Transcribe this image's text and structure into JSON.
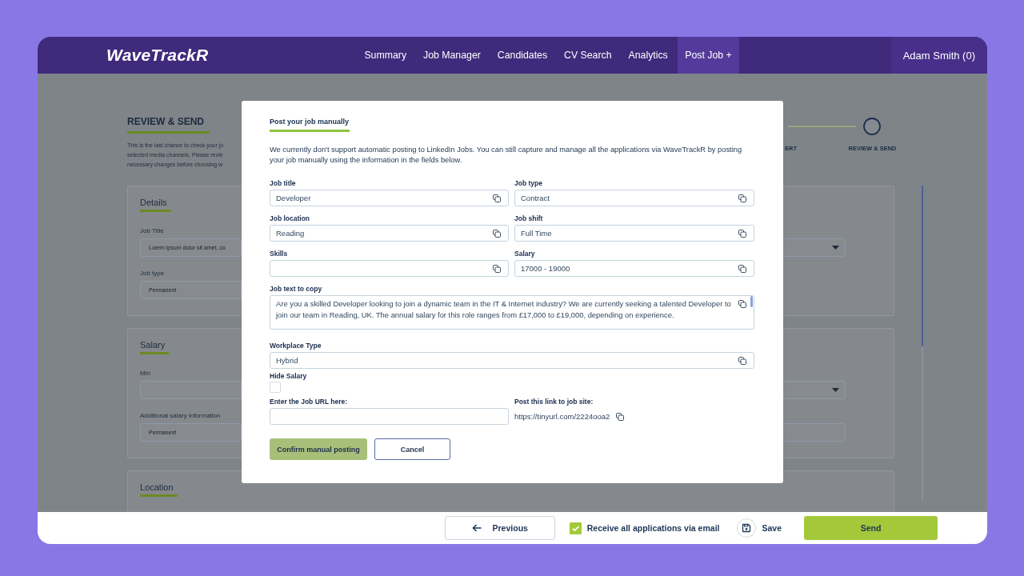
{
  "header": {
    "logo": "WaveTrackR",
    "nav": [
      {
        "label": "Summary",
        "selected": false
      },
      {
        "label": "Job Manager",
        "selected": false
      },
      {
        "label": "Candidates",
        "selected": false
      },
      {
        "label": "CV Search",
        "selected": false
      },
      {
        "label": "Analytics",
        "selected": false
      },
      {
        "label": "Post Job +",
        "selected": true
      }
    ],
    "user": "Adam Smith (0)"
  },
  "page": {
    "heading": "REVIEW & SEND",
    "description_lines": [
      "This is the last chance to check your jo",
      "selected media channels. Please revie",
      "necessary changes before choosing w"
    ],
    "stepper": {
      "cut_label": "ERT",
      "current_label": "REVIEW & SEND"
    },
    "cards": [
      {
        "title": "Details",
        "rows": [
          {
            "label": "Job Title",
            "value": "Lorem ipsum dolor sit amet, co",
            "right_field": {
              "kind": "select"
            }
          },
          {
            "label": "Job type",
            "value": "Permanent"
          }
        ]
      },
      {
        "title": "Salary",
        "rows": [
          {
            "label": "Min",
            "right_field": {
              "kind": "select"
            }
          },
          {
            "label": "Additional salary information",
            "value": "Permanent",
            "right_field": {
              "kind": "text"
            }
          }
        ]
      },
      {
        "title": "Location"
      }
    ]
  },
  "modal": {
    "title": "Post your job manually",
    "intro": "We currently don't support automatic posting to LinkedIn Jobs. You can still capture and manage all the applications via WaveTrackR by posting your job manually using the information in the fields below.",
    "fields": [
      {
        "kind": "text",
        "label": "Job title",
        "value": "Developer",
        "copyable": true
      },
      {
        "kind": "text",
        "label": "Job type",
        "value": "Contract",
        "copyable": true
      },
      {
        "kind": "text",
        "label": "Job location",
        "value": "Reading",
        "copyable": true
      },
      {
        "kind": "text",
        "label": "Job shift",
        "value": "Full Time",
        "copyable": true
      },
      {
        "kind": "text",
        "label": "Skills",
        "copyable": true
      },
      {
        "kind": "text",
        "label": "Salary",
        "value": "17000 - 19000",
        "copyable": true
      },
      {
        "kind": "textarea",
        "label": "Job text to copy",
        "value": "Are you a skilled Developer looking to join a dynamic team in the IT & Internet industry? We are currently seeking a talented Developer to join our team in Reading, UK. The annual salary for this role ranges from £17,000 to £19,000, depending on experience.",
        "copyable": true
      },
      {
        "kind": "wide",
        "label": "Workplace Type",
        "value": "Hybrid",
        "copyable": true
      },
      {
        "kind": "checkbox",
        "label": "Hide Salary",
        "checked": false
      },
      {
        "kind": "text",
        "label": "Enter the Job URL here:",
        "copyable": false
      },
      {
        "kind": "link",
        "label": "Post this link to job site:",
        "value": "https://tinyurl.com/2224ooa2",
        "copyable": true
      }
    ],
    "buttons": [
      {
        "label": "Confirm manual posting",
        "kind": "primary"
      },
      {
        "label": "Cancel",
        "kind": "secondary"
      }
    ]
  },
  "footer": {
    "previous": "Previous",
    "email_option": {
      "label": "Receive all applications via email",
      "checked": true
    },
    "save": "Save",
    "send": "Send"
  }
}
